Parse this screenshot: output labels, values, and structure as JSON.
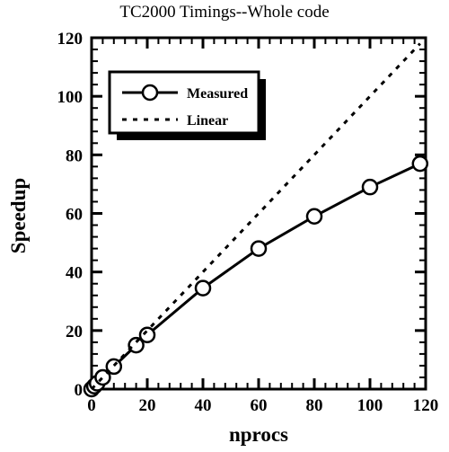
{
  "chart_data": {
    "type": "line",
    "title": "TC2000 Timings--Whole code",
    "xlabel": "nprocs",
    "ylabel": "Speedup",
    "xlim": [
      0,
      120
    ],
    "ylim": [
      0,
      120
    ],
    "xticks": [
      0,
      20,
      40,
      60,
      80,
      100,
      120
    ],
    "yticks": [
      0,
      20,
      40,
      60,
      80,
      100,
      120
    ],
    "xtick_labels": [
      "0",
      "20",
      "40",
      "60",
      "80",
      "100",
      "120"
    ],
    "ytick_labels": [
      "0",
      "20",
      "40",
      "60",
      "80",
      "100",
      "120"
    ],
    "minor_ticks_per_interval": 4,
    "grid": false,
    "legend_position": "upper left",
    "series": [
      {
        "name": "Measured",
        "style": "solid",
        "marker": "open-circle",
        "x": [
          0,
          1,
          2,
          4,
          8,
          16,
          20,
          40,
          60,
          80,
          100,
          118
        ],
        "values": [
          0,
          1,
          2,
          4,
          7.7,
          15.0,
          18.5,
          34.5,
          48.0,
          59.0,
          69.0,
          77.0
        ]
      },
      {
        "name": "Linear",
        "style": "dotted",
        "marker": "none",
        "x": [
          0,
          118
        ],
        "values": [
          0,
          118
        ]
      }
    ]
  },
  "legend": {
    "entries": [
      {
        "label": "Measured"
      },
      {
        "label": "Linear"
      }
    ]
  },
  "colors": {
    "background": "#ffffff",
    "foreground": "#000000"
  }
}
